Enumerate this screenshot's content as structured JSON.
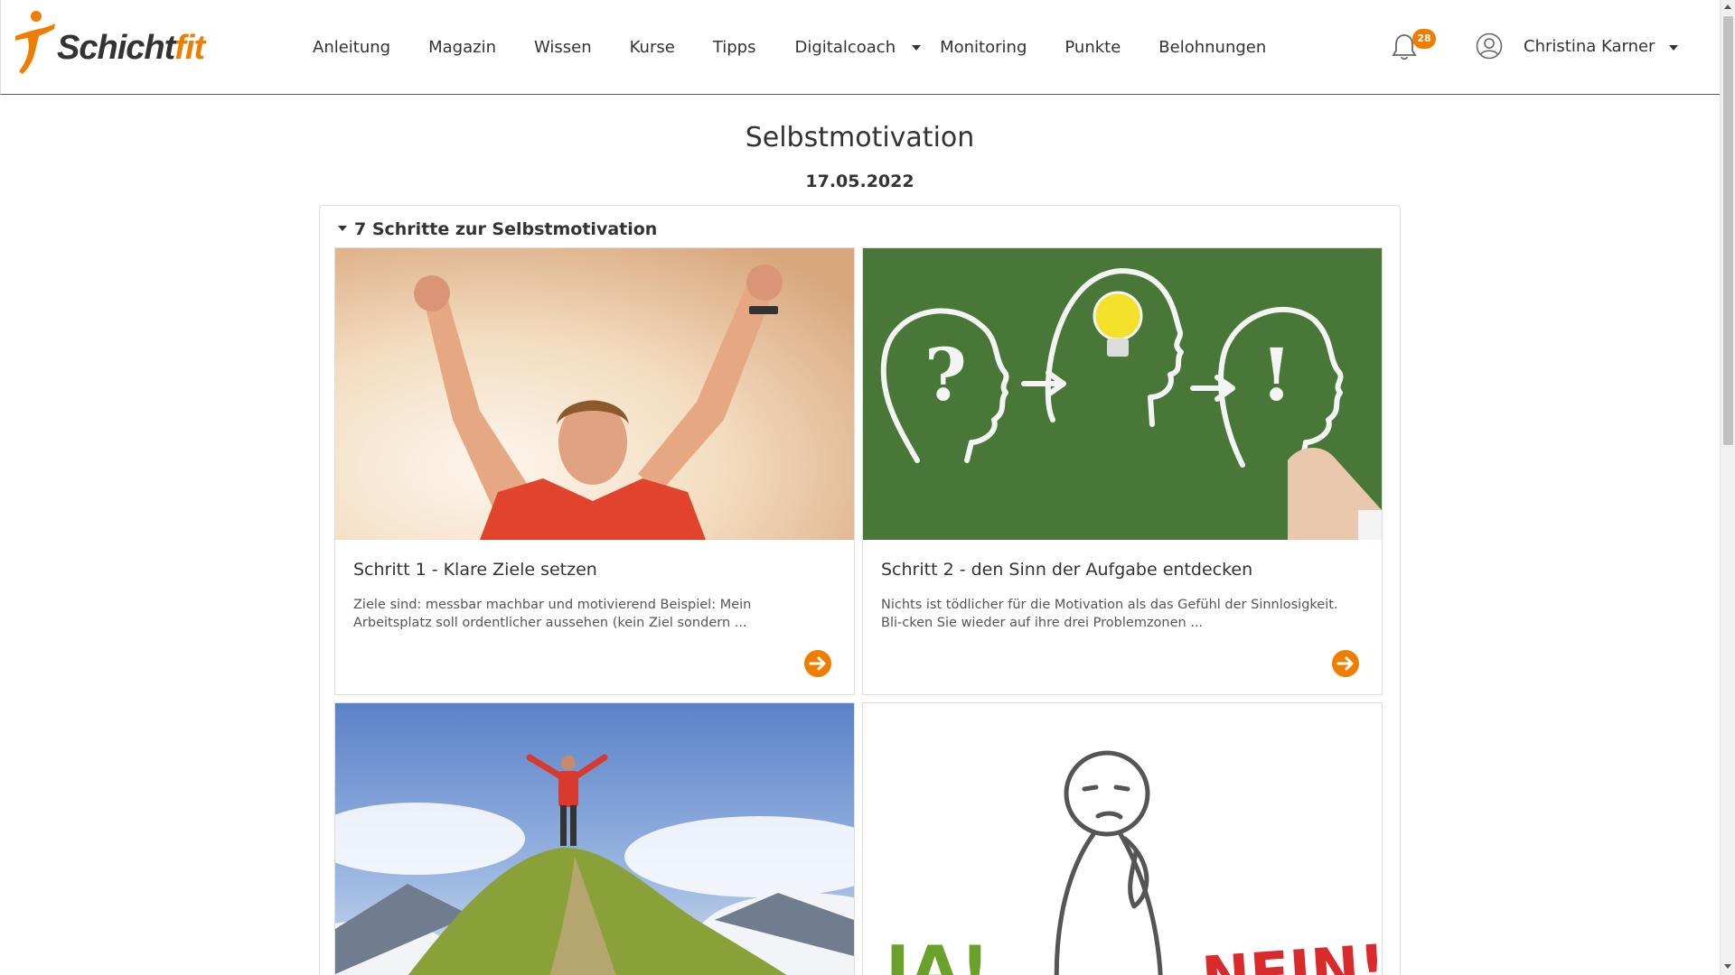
{
  "brand": {
    "part1": "Schicht",
    "part2": "fit",
    "accent": "#ef7d00"
  },
  "nav": {
    "items": [
      {
        "label": "Anleitung"
      },
      {
        "label": "Magazin"
      },
      {
        "label": "Wissen"
      },
      {
        "label": "Kurse"
      },
      {
        "label": "Tipps"
      },
      {
        "label": "Digitalcoach",
        "dropdown": true
      },
      {
        "label": "Monitoring"
      },
      {
        "label": "Punkte"
      },
      {
        "label": "Belohnungen"
      }
    ]
  },
  "header": {
    "notification_icon": "bell-icon",
    "notification_count": "28",
    "user_icon": "user-circle-icon",
    "user_name": "Christina Karner"
  },
  "page": {
    "title": "Selbstmotivation",
    "date": "17.05.2022"
  },
  "section": {
    "title": "7 Schritte zur Selbstmotivation",
    "expanded": true,
    "cards": [
      {
        "title": "Schritt 1 - Klare Ziele setzen",
        "text": "Ziele sind: messbar machbar und motivierend Beispiel: Mein Arbeitsplatz soll ordentlicher aussehen (kein Ziel sondern ...",
        "arrow_icon": "arrow-right-circle-icon"
      },
      {
        "title": "Schritt 2 - den Sinn der Aufgabe entdecken",
        "text": "Nichts ist tödlicher für die Motivation als das Gefühl der Sinnlosigkeit. Bli-cken Sie wieder auf ihre drei Problemzonen ...",
        "arrow_icon": "arrow-right-circle-icon"
      },
      {
        "title": "",
        "text": ""
      },
      {
        "title": "",
        "text": "",
        "image_text_left": "JA!",
        "image_text_right": "NEIN!"
      }
    ]
  },
  "colors": {
    "primary_text": "#333333",
    "accent": "#ef7d00",
    "border": "#dddddd"
  }
}
